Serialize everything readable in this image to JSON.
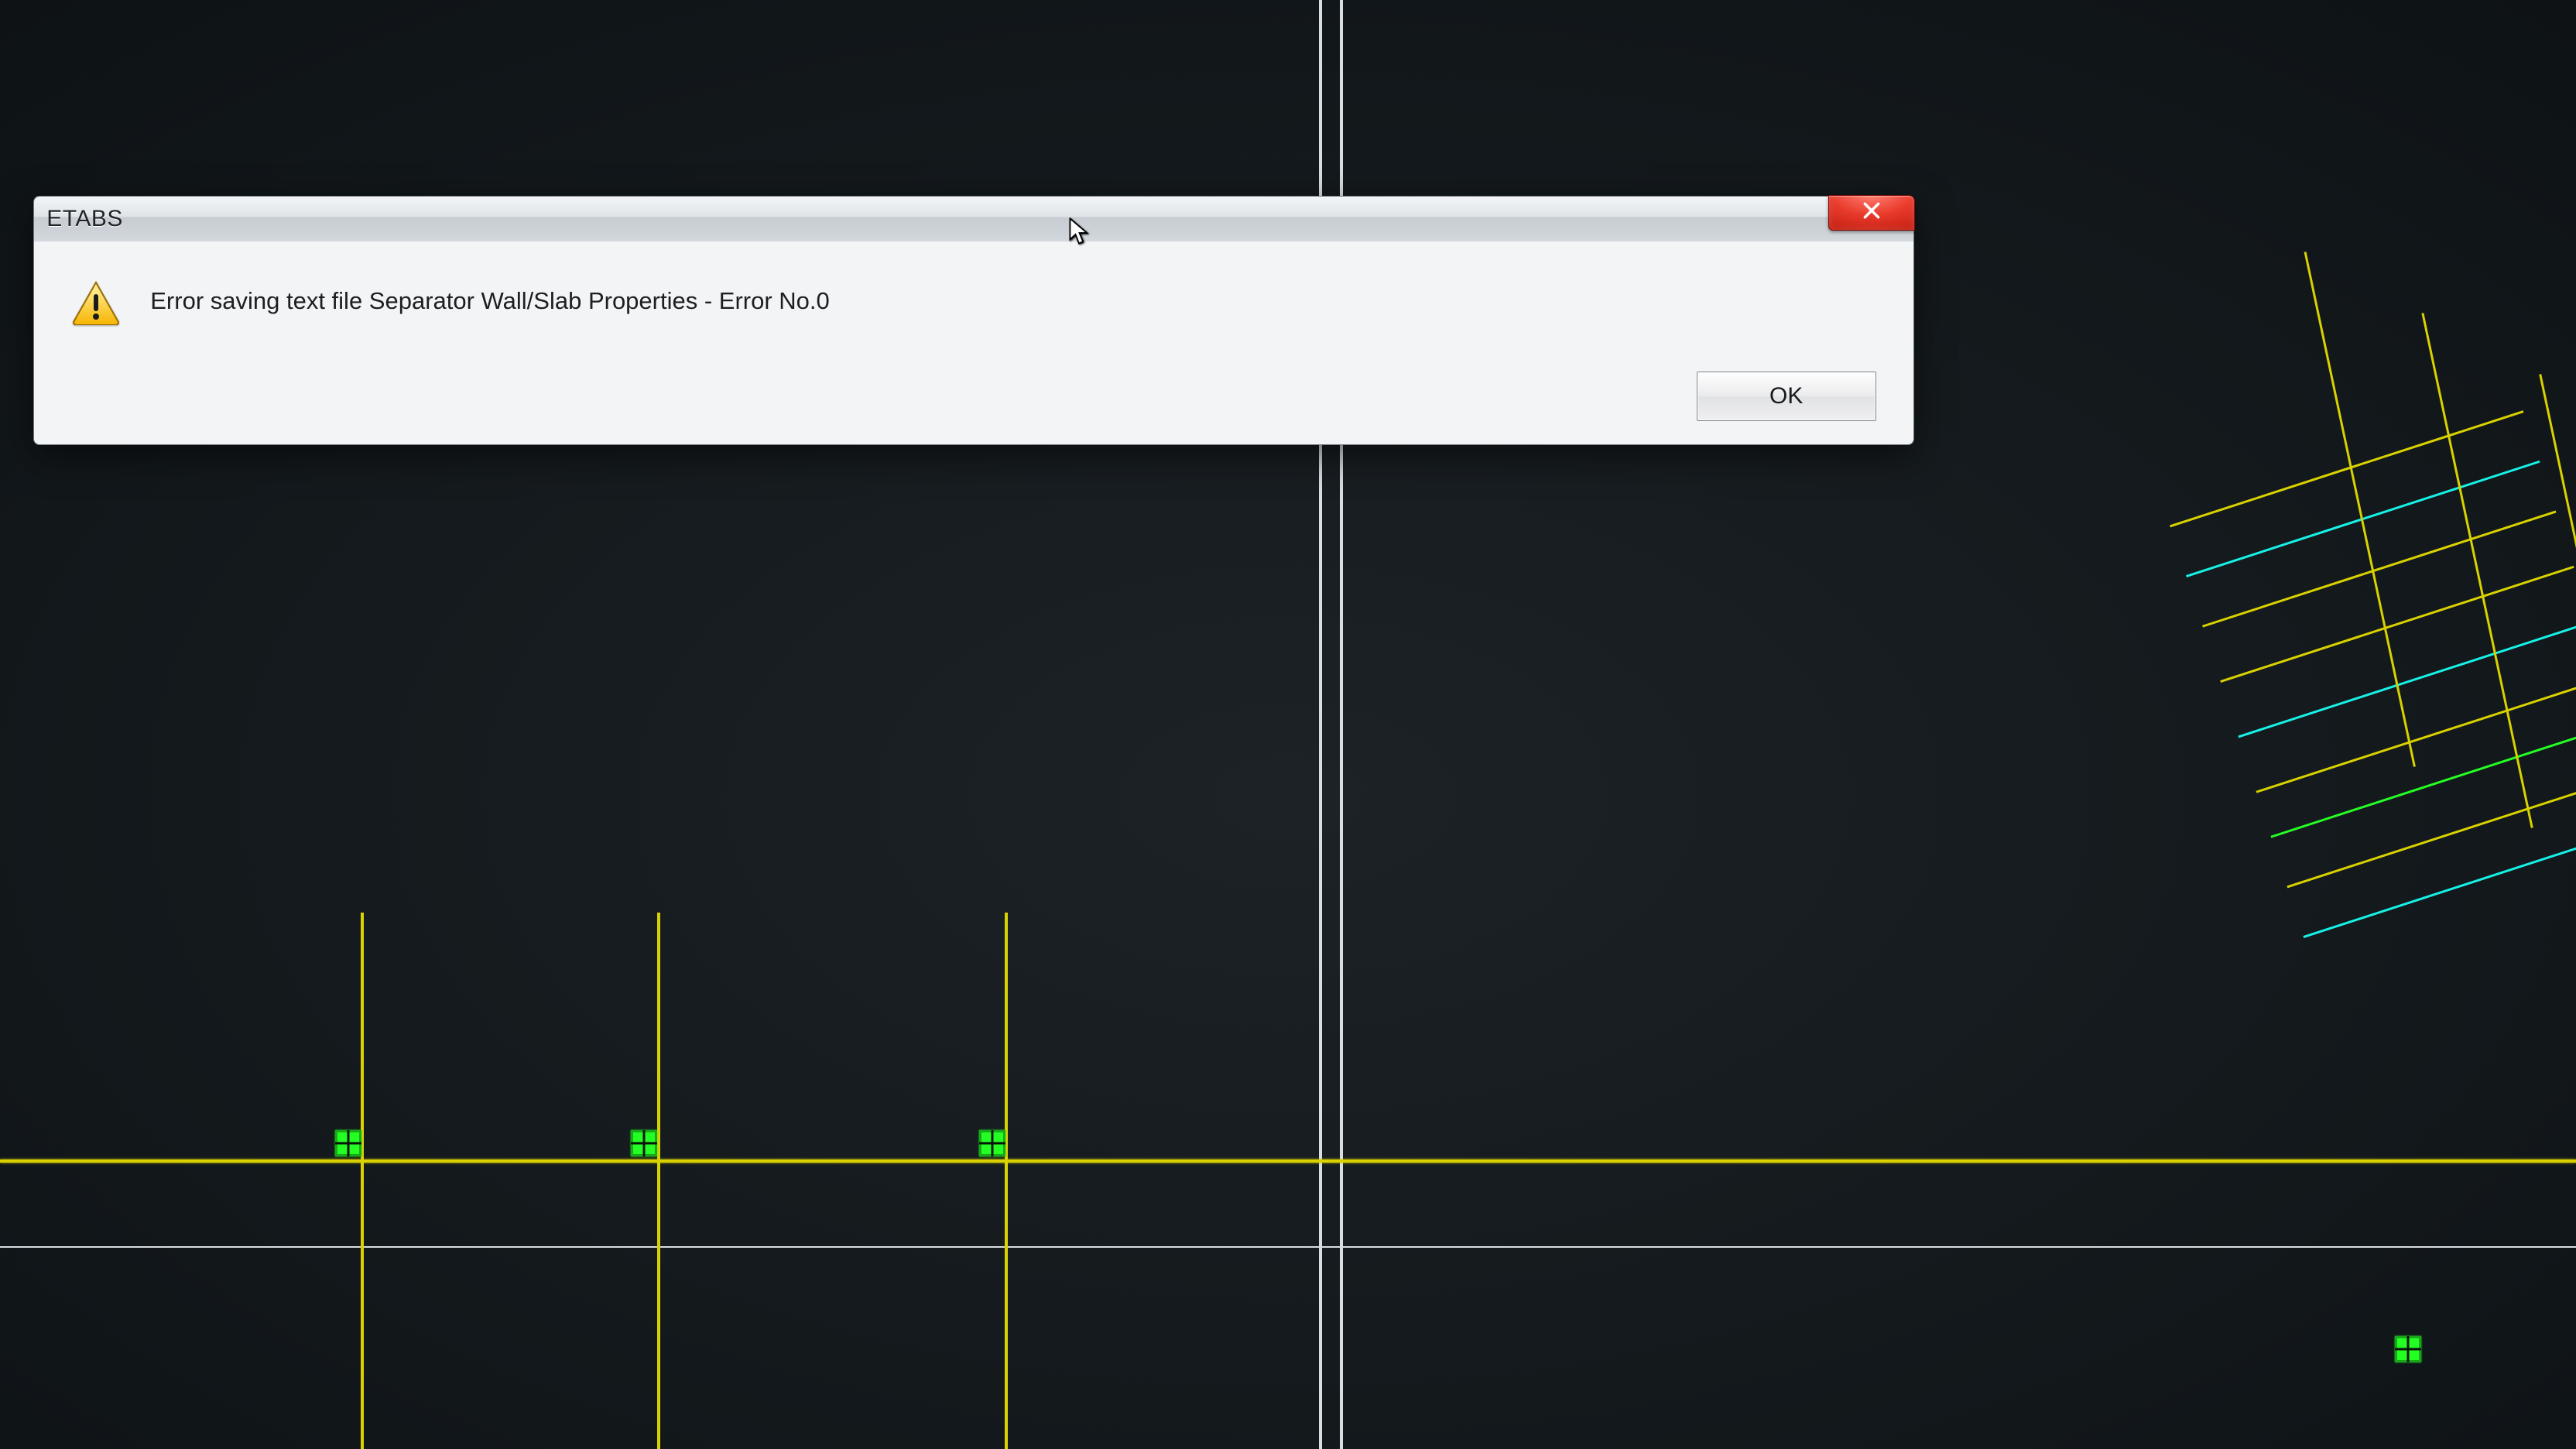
{
  "dialog": {
    "title": "ETABS",
    "message": "Error saving text file Separator Wall/Slab Properties - Error No.0",
    "ok_label": "OK",
    "icon": "warning",
    "close_icon": "close-x"
  }
}
